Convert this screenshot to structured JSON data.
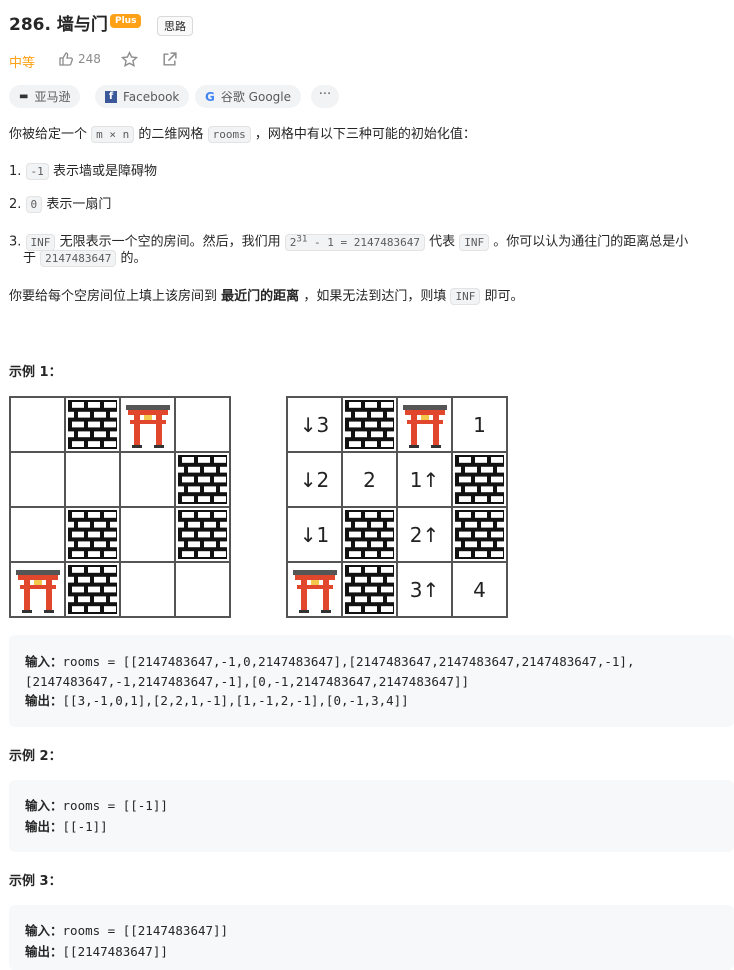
{
  "problem": {
    "title": "286. 墙与门",
    "plus_label": "Plus",
    "hint_label": "思路",
    "difficulty": "中等",
    "likes": "248"
  },
  "companies": [
    "亚马逊",
    "Facebook",
    "谷歌 Google"
  ],
  "more_label": "···",
  "description": {
    "intro_before": "你被给定一个",
    "intro_code": "m × n",
    "intro_after": "的二维网格",
    "rooms_code": "rooms",
    "intro_tail": "，网格中有以下三种可能的初始化值：",
    "item1_code": "-1",
    "item1_text": "表示墙或是障碍物",
    "item2_code": "0",
    "item2_text": "表示一扇门",
    "item3_code": "INF",
    "item3_text": "无限表示一个空的房间。然后，我们用",
    "item3_formula_base": "2",
    "item3_formula_exp": "31",
    "item3_formula_rest": "- 1 = 2147483647",
    "item3_after": "代表",
    "item3_inf": "INF",
    "item3_tail": "。你可以认为通往门的距离总是小",
    "item3_line2_pre": "于",
    "item3_line2_code": "2147483647",
    "item3_line2_post": "的。",
    "task_before": "你要给每个空房间位上填上该房间到",
    "task_bold": "最近门的距离",
    "task_after": "，如果无法到达门，则填",
    "task_code": "INF",
    "task_tail": "即可。"
  },
  "examples": [
    {
      "title": "示例 1：",
      "input_label": "输入：",
      "input_line1": "rooms = [[2147483647,-1,0,2147483647],[2147483647,2147483647,2147483647,-1],",
      "input_line2": "[2147483647,-1,2147483647,-1],[0,-1,2147483647,2147483647]]",
      "output_label": "输出：",
      "output": "[[3,-1,0,1],[2,2,1,-1],[1,-1,2,-1],[0,-1,3,4]]"
    },
    {
      "title": "示例 2：",
      "input_label": "输入：",
      "input_line1": "rooms = [[-1]]",
      "output_label": "输出：",
      "output": "[[-1]]"
    },
    {
      "title": "示例 3：",
      "input_label": "输入：",
      "input_line1": "rooms = [[2147483647]]",
      "output_label": "输出：",
      "output": "[[2147483647]]"
    }
  ],
  "grid_left": [
    [
      "",
      "wall",
      "gate",
      ""
    ],
    [
      "",
      "",
      "",
      "wall"
    ],
    [
      "",
      "wall",
      "",
      "wall"
    ],
    [
      "gate",
      "wall",
      "",
      ""
    ]
  ],
  "grid_right": [
    [
      "↓3",
      "wall",
      "gate",
      "1"
    ],
    [
      "↓2",
      "2",
      "1↑",
      "wall"
    ],
    [
      "↓1",
      "wall",
      "2↑",
      "wall"
    ],
    [
      "gate",
      "wall",
      "3↑",
      "4"
    ]
  ],
  "colors": {
    "accent": "#ffa116",
    "gate": "#e0472d"
  }
}
